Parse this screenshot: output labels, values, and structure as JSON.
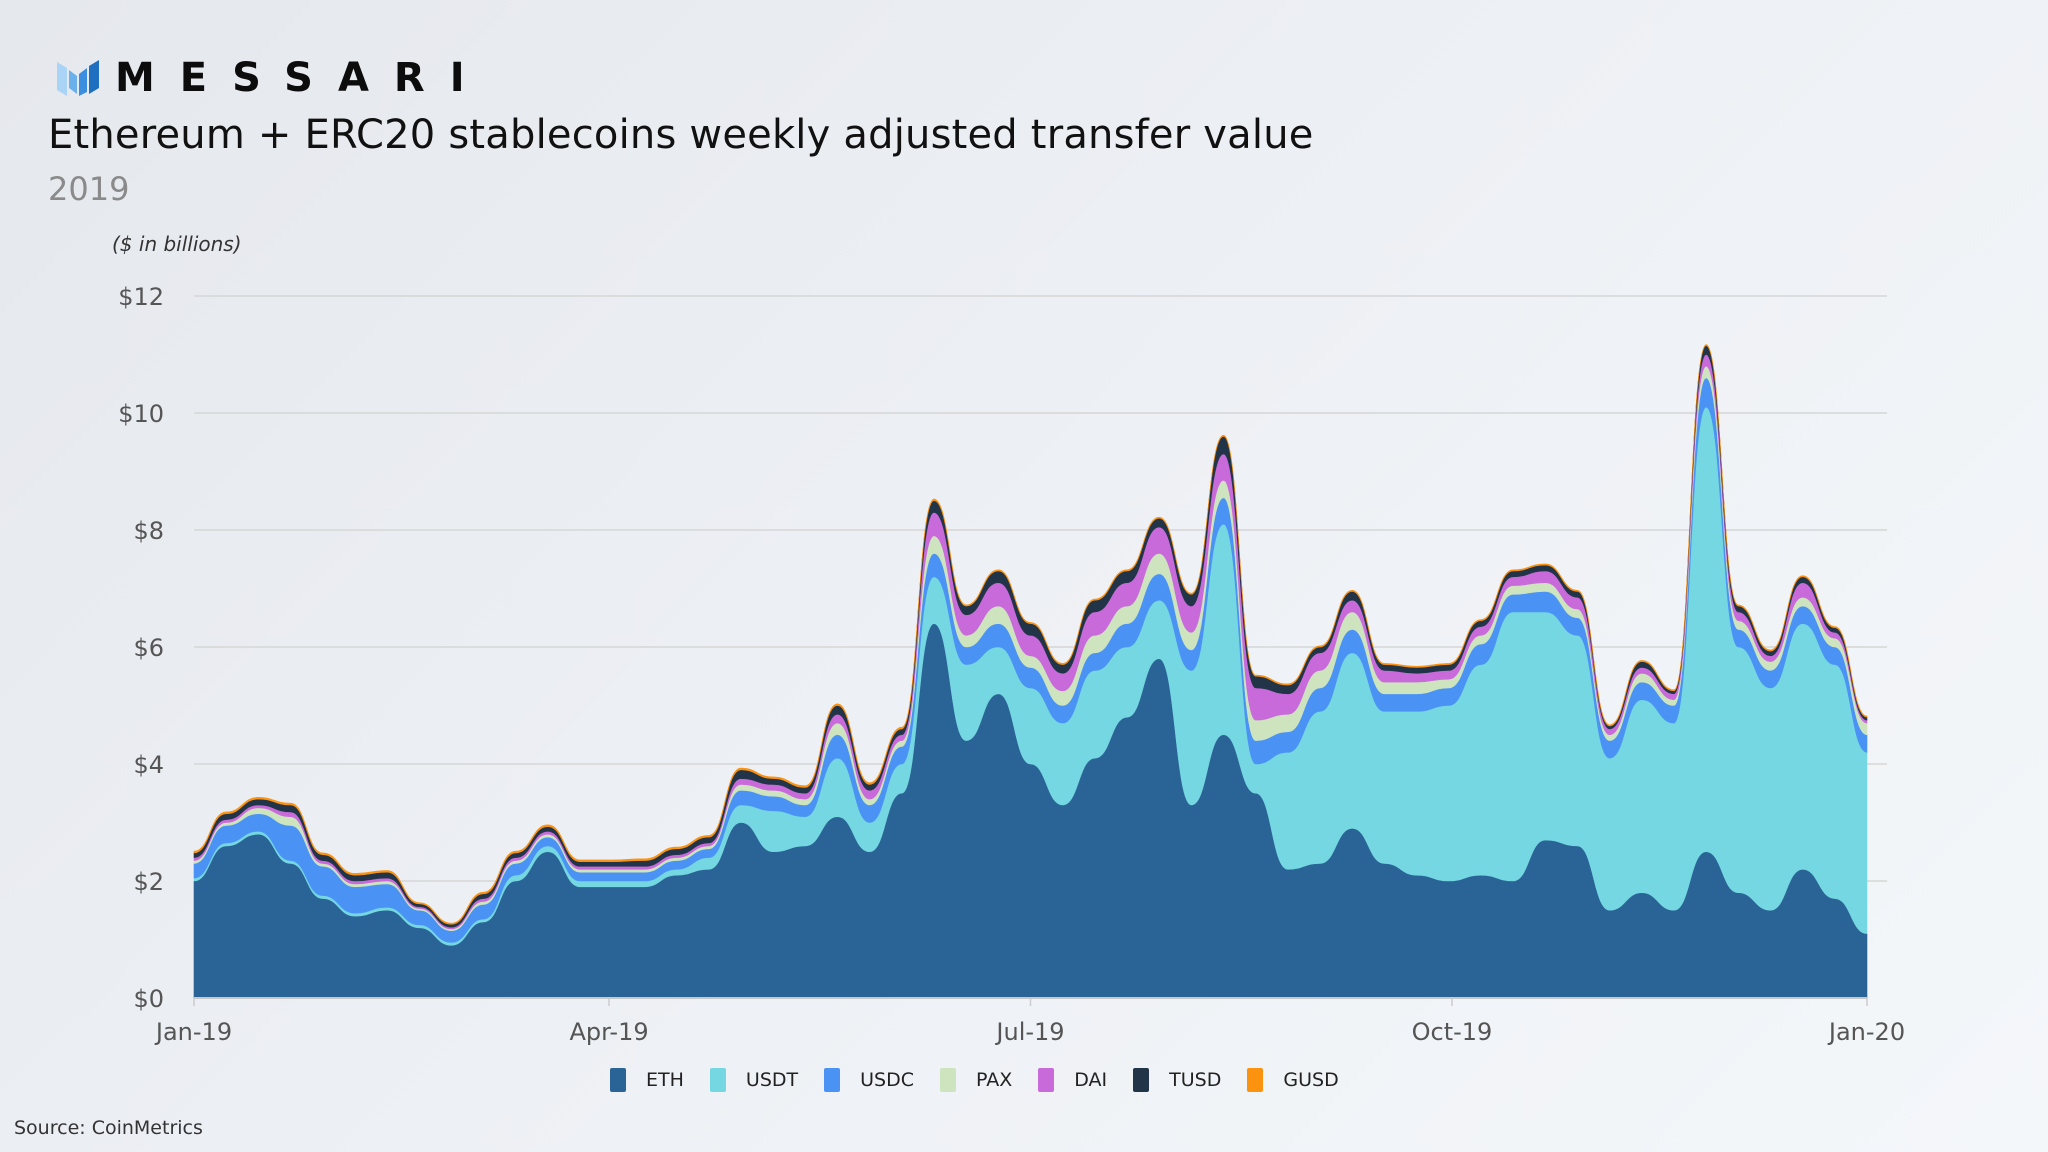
{
  "brand": {
    "name": "MESSARI",
    "logo_icon": "messari-logo-icon"
  },
  "header": {
    "title": "Ethereum + ERC20 stablecoins weekly adjusted transfer value",
    "subtitle": "2019"
  },
  "source": "Source: CoinMetrics",
  "chart_data": {
    "type": "area",
    "stacked": true,
    "title": "Ethereum + ERC20 stablecoins weekly adjusted transfer value",
    "subtitle": "2019",
    "ylabel": "($ in billions)",
    "xlabel": "",
    "ylim": [
      0,
      12
    ],
    "yticks": [
      0,
      2,
      4,
      6,
      8,
      10,
      12
    ],
    "ytick_labels": [
      "$0",
      "$2",
      "$4",
      "$6",
      "$8",
      "$10",
      "$12"
    ],
    "xlim_weeks": [
      0,
      52
    ],
    "xticks_weeks": [
      0,
      12.9,
      26,
      39.1,
      52
    ],
    "xtick_labels": [
      "Jan-19",
      "Apr-19",
      "Jul-19",
      "Oct-19",
      "Jan-20"
    ],
    "grid": true,
    "legend_position": "bottom",
    "x_weeks": [
      0,
      1,
      2,
      3,
      4,
      5,
      6,
      7,
      8,
      9,
      10,
      11,
      12,
      13,
      14,
      15,
      16,
      17,
      18,
      19,
      20,
      21,
      22,
      23,
      24,
      25,
      26,
      27,
      28,
      29,
      30,
      31,
      32,
      33,
      34,
      35,
      36,
      37,
      38,
      39,
      40,
      41,
      42,
      43,
      44,
      45,
      46,
      47,
      48,
      49,
      50,
      51,
      52
    ],
    "series": [
      {
        "name": "ETH",
        "color": "#2a6496",
        "values": [
          2.0,
          2.6,
          2.8,
          2.3,
          1.7,
          1.4,
          1.5,
          1.2,
          0.9,
          1.3,
          2.0,
          2.5,
          1.9,
          1.9,
          1.9,
          2.1,
          2.2,
          3.0,
          2.5,
          2.6,
          3.1,
          2.5,
          3.5,
          6.4,
          4.4,
          5.2,
          4.0,
          3.3,
          4.1,
          4.8,
          5.8,
          3.3,
          4.5,
          3.5,
          2.2,
          2.3,
          2.9,
          2.3,
          2.1,
          2.0,
          2.1,
          2.0,
          2.7,
          2.6,
          1.5,
          1.8,
          1.5,
          2.5,
          1.8,
          1.5,
          2.2,
          1.7,
          1.1
        ]
      },
      {
        "name": "USDT",
        "color": "#74d7e1",
        "values": [
          0.05,
          0.05,
          0.05,
          0.05,
          0.05,
          0.05,
          0.05,
          0.05,
          0.05,
          0.05,
          0.1,
          0.1,
          0.1,
          0.1,
          0.1,
          0.1,
          0.2,
          0.3,
          0.7,
          0.5,
          1.0,
          0.5,
          0.5,
          0.8,
          1.3,
          0.8,
          1.3,
          1.4,
          1.5,
          1.2,
          1.0,
          2.3,
          3.6,
          0.5,
          2.0,
          2.6,
          3.0,
          2.6,
          2.8,
          3.0,
          3.6,
          4.6,
          3.9,
          3.6,
          2.6,
          3.3,
          3.2,
          7.6,
          4.2,
          3.8,
          4.2,
          4.0,
          3.1
        ]
      },
      {
        "name": "USDC",
        "color": "#4a93f5",
        "values": [
          0.25,
          0.3,
          0.3,
          0.6,
          0.5,
          0.45,
          0.4,
          0.25,
          0.2,
          0.25,
          0.2,
          0.15,
          0.15,
          0.15,
          0.15,
          0.15,
          0.15,
          0.25,
          0.25,
          0.2,
          0.4,
          0.3,
          0.3,
          0.4,
          0.3,
          0.4,
          0.35,
          0.3,
          0.3,
          0.4,
          0.45,
          0.35,
          0.45,
          0.4,
          0.35,
          0.4,
          0.4,
          0.3,
          0.3,
          0.3,
          0.35,
          0.3,
          0.35,
          0.3,
          0.3,
          0.3,
          0.3,
          0.5,
          0.3,
          0.3,
          0.3,
          0.3,
          0.3
        ]
      },
      {
        "name": "PAX",
        "color": "#cde4be",
        "values": [
          0.05,
          0.05,
          0.1,
          0.15,
          0.05,
          0.05,
          0.05,
          0.03,
          0.03,
          0.05,
          0.05,
          0.05,
          0.05,
          0.05,
          0.05,
          0.05,
          0.05,
          0.1,
          0.1,
          0.1,
          0.2,
          0.1,
          0.1,
          0.3,
          0.2,
          0.3,
          0.2,
          0.25,
          0.3,
          0.3,
          0.35,
          0.3,
          0.3,
          0.35,
          0.3,
          0.3,
          0.3,
          0.2,
          0.2,
          0.15,
          0.15,
          0.15,
          0.15,
          0.15,
          0.1,
          0.15,
          0.1,
          0.2,
          0.15,
          0.15,
          0.15,
          0.15,
          0.2
        ]
      },
      {
        "name": "DAI",
        "color": "#c96ada",
        "values": [
          0.05,
          0.05,
          0.05,
          0.08,
          0.05,
          0.05,
          0.05,
          0.03,
          0.03,
          0.05,
          0.05,
          0.05,
          0.05,
          0.05,
          0.05,
          0.05,
          0.05,
          0.1,
          0.1,
          0.1,
          0.15,
          0.15,
          0.1,
          0.4,
          0.35,
          0.4,
          0.35,
          0.3,
          0.4,
          0.4,
          0.45,
          0.45,
          0.45,
          0.55,
          0.35,
          0.3,
          0.2,
          0.2,
          0.15,
          0.15,
          0.15,
          0.15,
          0.2,
          0.2,
          0.1,
          0.1,
          0.1,
          0.2,
          0.15,
          0.1,
          0.25,
          0.1,
          0.05
        ]
      },
      {
        "name": "TUSD",
        "color": "#223548",
        "values": [
          0.08,
          0.1,
          0.1,
          0.12,
          0.1,
          0.1,
          0.1,
          0.05,
          0.05,
          0.08,
          0.08,
          0.08,
          0.08,
          0.08,
          0.1,
          0.1,
          0.1,
          0.15,
          0.1,
          0.1,
          0.15,
          0.1,
          0.1,
          0.2,
          0.15,
          0.2,
          0.2,
          0.15,
          0.2,
          0.2,
          0.15,
          0.2,
          0.3,
          0.2,
          0.15,
          0.1,
          0.15,
          0.1,
          0.1,
          0.1,
          0.1,
          0.1,
          0.1,
          0.1,
          0.05,
          0.1,
          0.05,
          0.15,
          0.1,
          0.08,
          0.1,
          0.08,
          0.05
        ]
      },
      {
        "name": "GUSD",
        "color": "#fb9210",
        "values": [
          0.03,
          0.03,
          0.03,
          0.03,
          0.03,
          0.03,
          0.03,
          0.02,
          0.02,
          0.03,
          0.03,
          0.03,
          0.03,
          0.03,
          0.03,
          0.03,
          0.03,
          0.03,
          0.03,
          0.03,
          0.03,
          0.03,
          0.03,
          0.03,
          0.02,
          0.02,
          0.02,
          0.02,
          0.02,
          0.02,
          0.02,
          0.02,
          0.02,
          0.02,
          0.02,
          0.02,
          0.02,
          0.02,
          0.02,
          0.02,
          0.02,
          0.02,
          0.02,
          0.02,
          0.02,
          0.02,
          0.02,
          0.02,
          0.02,
          0.02,
          0.02,
          0.02,
          0.02
        ]
      }
    ]
  }
}
